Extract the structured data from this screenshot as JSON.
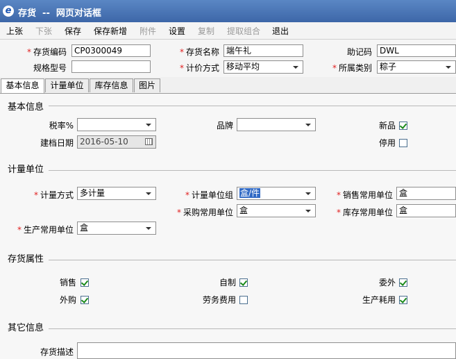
{
  "window": {
    "title": "存货  --  网页对话框"
  },
  "toolbar": {
    "up": "上张",
    "down": "下张",
    "save": "保存",
    "save_new": "保存新增",
    "attach": "附件",
    "settings": "设置",
    "copy": "复制",
    "extract": "提取组合",
    "exit": "退出"
  },
  "header": {
    "code_label": "存货编码",
    "code_value": "CP0300049",
    "name_label": "存货名称",
    "name_value": "端午礼",
    "mnemonic_label": "助记码",
    "mnemonic_value": "DWL",
    "spec_label": "规格型号",
    "spec_value": "",
    "pricing_label": "计价方式",
    "pricing_value": "移动平均",
    "category_label": "所属类别",
    "category_value": "粽子"
  },
  "tabs": [
    "基本信息",
    "计量单位",
    "库存信息",
    "图片"
  ],
  "basic": {
    "section": "基本信息",
    "tax_label": "税率%",
    "tax_value": "",
    "brand_label": "品牌",
    "brand_value": "",
    "new_label": "新品",
    "new_checked": true,
    "date_label": "建档日期",
    "date_value": "2016-05-10",
    "disabled_label": "停用",
    "disabled_checked": false
  },
  "units": {
    "section": "计量单位",
    "method_label": "计量方式",
    "method_value": "多计量",
    "group_label": "计量单位组",
    "group_value": "盒/件",
    "sales_label": "销售常用单位",
    "sales_value": "盒",
    "purchase_label": "采购常用单位",
    "purchase_value": "盒",
    "stock_label": "库存常用单位",
    "stock_value": "盒",
    "production_label": "生产常用单位",
    "production_value": "盒"
  },
  "attributes": {
    "section": "存货属性",
    "items": [
      {
        "label": "销售",
        "checked": true
      },
      {
        "label": "自制",
        "checked": true
      },
      {
        "label": "委外",
        "checked": true
      },
      {
        "label": "外购",
        "checked": true
      },
      {
        "label": "劳务费用",
        "checked": false
      },
      {
        "label": "生产耗用",
        "checked": true
      }
    ]
  },
  "other": {
    "section": "其它信息",
    "desc_label": "存货描述",
    "desc_value": ""
  },
  "colors": {
    "titlebar": "#3d67a8",
    "required": "#e02020",
    "check": "#1a8a1a",
    "highlight": "#316ac5"
  },
  "icons": {
    "window": "ie-icon",
    "calendar": "calendar-icon",
    "dropdown": "chevron-down-icon"
  }
}
